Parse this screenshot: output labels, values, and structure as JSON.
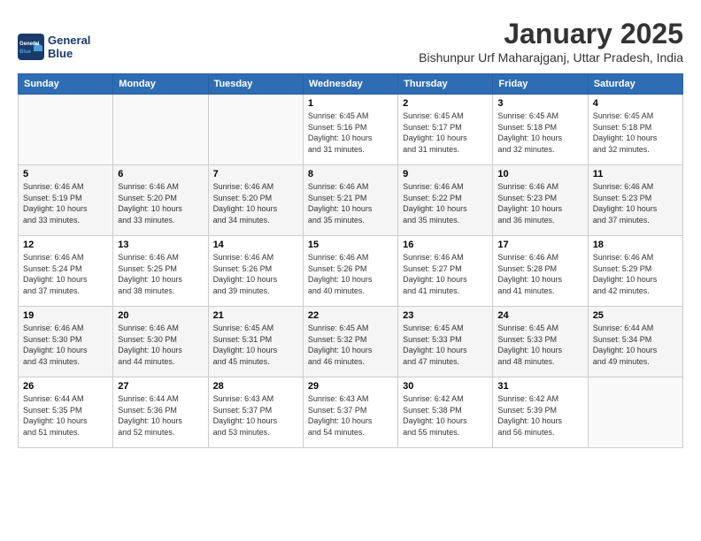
{
  "logo": {
    "line1": "General",
    "line2": "Blue"
  },
  "title": "January 2025",
  "subtitle": "Bishunpur Urf Maharajganj, Uttar Pradesh, India",
  "days_of_week": [
    "Sunday",
    "Monday",
    "Tuesday",
    "Wednesday",
    "Thursday",
    "Friday",
    "Saturday"
  ],
  "weeks": [
    [
      {
        "day": "",
        "details": ""
      },
      {
        "day": "",
        "details": ""
      },
      {
        "day": "",
        "details": ""
      },
      {
        "day": "1",
        "details": "Sunrise: 6:45 AM\nSunset: 5:16 PM\nDaylight: 10 hours\nand 31 minutes."
      },
      {
        "day": "2",
        "details": "Sunrise: 6:45 AM\nSunset: 5:17 PM\nDaylight: 10 hours\nand 31 minutes."
      },
      {
        "day": "3",
        "details": "Sunrise: 6:45 AM\nSunset: 5:18 PM\nDaylight: 10 hours\nand 32 minutes."
      },
      {
        "day": "4",
        "details": "Sunrise: 6:45 AM\nSunset: 5:18 PM\nDaylight: 10 hours\nand 32 minutes."
      }
    ],
    [
      {
        "day": "5",
        "details": "Sunrise: 6:46 AM\nSunset: 5:19 PM\nDaylight: 10 hours\nand 33 minutes."
      },
      {
        "day": "6",
        "details": "Sunrise: 6:46 AM\nSunset: 5:20 PM\nDaylight: 10 hours\nand 33 minutes."
      },
      {
        "day": "7",
        "details": "Sunrise: 6:46 AM\nSunset: 5:20 PM\nDaylight: 10 hours\nand 34 minutes."
      },
      {
        "day": "8",
        "details": "Sunrise: 6:46 AM\nSunset: 5:21 PM\nDaylight: 10 hours\nand 35 minutes."
      },
      {
        "day": "9",
        "details": "Sunrise: 6:46 AM\nSunset: 5:22 PM\nDaylight: 10 hours\nand 35 minutes."
      },
      {
        "day": "10",
        "details": "Sunrise: 6:46 AM\nSunset: 5:23 PM\nDaylight: 10 hours\nand 36 minutes."
      },
      {
        "day": "11",
        "details": "Sunrise: 6:46 AM\nSunset: 5:23 PM\nDaylight: 10 hours\nand 37 minutes."
      }
    ],
    [
      {
        "day": "12",
        "details": "Sunrise: 6:46 AM\nSunset: 5:24 PM\nDaylight: 10 hours\nand 37 minutes."
      },
      {
        "day": "13",
        "details": "Sunrise: 6:46 AM\nSunset: 5:25 PM\nDaylight: 10 hours\nand 38 minutes."
      },
      {
        "day": "14",
        "details": "Sunrise: 6:46 AM\nSunset: 5:26 PM\nDaylight: 10 hours\nand 39 minutes."
      },
      {
        "day": "15",
        "details": "Sunrise: 6:46 AM\nSunset: 5:26 PM\nDaylight: 10 hours\nand 40 minutes."
      },
      {
        "day": "16",
        "details": "Sunrise: 6:46 AM\nSunset: 5:27 PM\nDaylight: 10 hours\nand 41 minutes."
      },
      {
        "day": "17",
        "details": "Sunrise: 6:46 AM\nSunset: 5:28 PM\nDaylight: 10 hours\nand 41 minutes."
      },
      {
        "day": "18",
        "details": "Sunrise: 6:46 AM\nSunset: 5:29 PM\nDaylight: 10 hours\nand 42 minutes."
      }
    ],
    [
      {
        "day": "19",
        "details": "Sunrise: 6:46 AM\nSunset: 5:30 PM\nDaylight: 10 hours\nand 43 minutes."
      },
      {
        "day": "20",
        "details": "Sunrise: 6:46 AM\nSunset: 5:30 PM\nDaylight: 10 hours\nand 44 minutes."
      },
      {
        "day": "21",
        "details": "Sunrise: 6:45 AM\nSunset: 5:31 PM\nDaylight: 10 hours\nand 45 minutes."
      },
      {
        "day": "22",
        "details": "Sunrise: 6:45 AM\nSunset: 5:32 PM\nDaylight: 10 hours\nand 46 minutes."
      },
      {
        "day": "23",
        "details": "Sunrise: 6:45 AM\nSunset: 5:33 PM\nDaylight: 10 hours\nand 47 minutes."
      },
      {
        "day": "24",
        "details": "Sunrise: 6:45 AM\nSunset: 5:33 PM\nDaylight: 10 hours\nand 48 minutes."
      },
      {
        "day": "25",
        "details": "Sunrise: 6:44 AM\nSunset: 5:34 PM\nDaylight: 10 hours\nand 49 minutes."
      }
    ],
    [
      {
        "day": "26",
        "details": "Sunrise: 6:44 AM\nSunset: 5:35 PM\nDaylight: 10 hours\nand 51 minutes."
      },
      {
        "day": "27",
        "details": "Sunrise: 6:44 AM\nSunset: 5:36 PM\nDaylight: 10 hours\nand 52 minutes."
      },
      {
        "day": "28",
        "details": "Sunrise: 6:43 AM\nSunset: 5:37 PM\nDaylight: 10 hours\nand 53 minutes."
      },
      {
        "day": "29",
        "details": "Sunrise: 6:43 AM\nSunset: 5:37 PM\nDaylight: 10 hours\nand 54 minutes."
      },
      {
        "day": "30",
        "details": "Sunrise: 6:42 AM\nSunset: 5:38 PM\nDaylight: 10 hours\nand 55 minutes."
      },
      {
        "day": "31",
        "details": "Sunrise: 6:42 AM\nSunset: 5:39 PM\nDaylight: 10 hours\nand 56 minutes."
      },
      {
        "day": "",
        "details": ""
      }
    ]
  ]
}
